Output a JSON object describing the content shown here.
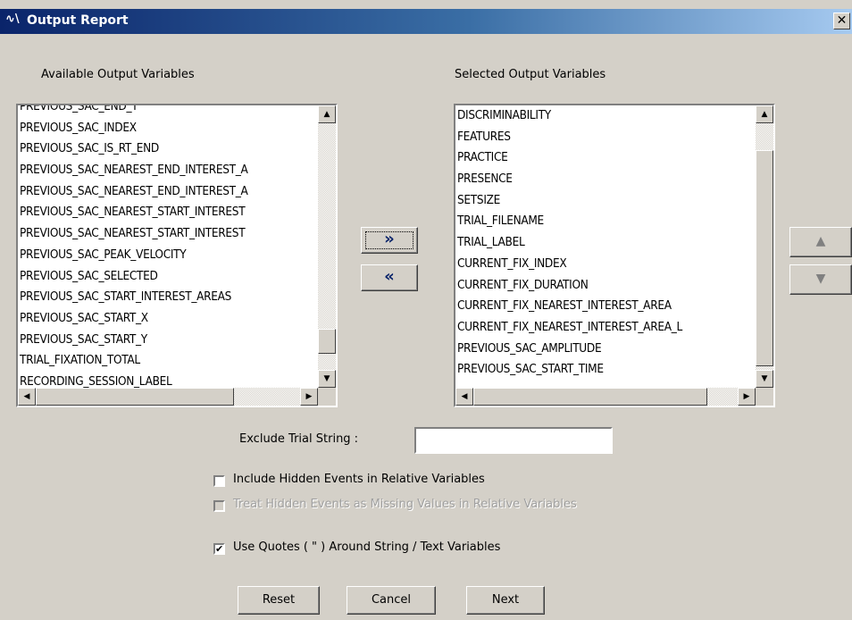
{
  "window": {
    "title": "Output Report",
    "title_icon": "∿\\",
    "close_glyph": "✕"
  },
  "available": {
    "label": "Available Output Variables",
    "items": [
      "PREVIOUS_SAC_END_Y",
      "PREVIOUS_SAC_INDEX",
      "PREVIOUS_SAC_IS_RT_END",
      "PREVIOUS_SAC_NEAREST_END_INTEREST_A",
      "PREVIOUS_SAC_NEAREST_END_INTEREST_A",
      "PREVIOUS_SAC_NEAREST_START_INTEREST",
      "PREVIOUS_SAC_NEAREST_START_INTEREST",
      "PREVIOUS_SAC_PEAK_VELOCITY",
      "PREVIOUS_SAC_SELECTED",
      "PREVIOUS_SAC_START_INTEREST_AREAS",
      "PREVIOUS_SAC_START_X",
      "PREVIOUS_SAC_START_Y",
      "TRIAL_FIXATION_TOTAL",
      "RECORDING_SESSION_LABEL"
    ]
  },
  "selected": {
    "label": "Selected Output Variables",
    "items": [
      "DISCRIMINABILITY",
      "FEATURES",
      "PRACTICE",
      "PRESENCE",
      "SETSIZE",
      "TRIAL_FILENAME",
      "TRIAL_LABEL",
      "CURRENT_FIX_INDEX",
      "CURRENT_FIX_DURATION",
      "CURRENT_FIX_NEAREST_INTEREST_AREA",
      "CURRENT_FIX_NEAREST_INTEREST_AREA_L",
      "PREVIOUS_SAC_AMPLITUDE",
      "PREVIOUS_SAC_START_TIME"
    ]
  },
  "transfer": {
    "add_label": "»",
    "remove_label": "«"
  },
  "order": {
    "up_glyph": "▲",
    "down_glyph": "▼"
  },
  "exclude": {
    "label": "Exclude Trial String :",
    "value": ""
  },
  "options": {
    "include_hidden": {
      "label": "Include Hidden Events in Relative Variables",
      "checked": false,
      "enabled": true
    },
    "treat_hidden": {
      "label": "Treat Hidden Events as Missing Values in Relative Variables",
      "checked": false,
      "enabled": false
    },
    "use_quotes": {
      "label": "Use Quotes ( \" ) Around String /  Text Variables",
      "checked": true,
      "enabled": true
    }
  },
  "buttons": {
    "reset": "Reset",
    "cancel": "Cancel",
    "next": "Next"
  },
  "icons": {
    "scroll_up": "▲",
    "scroll_down": "▼",
    "scroll_left": "◀",
    "scroll_right": "▶",
    "check": "✔"
  }
}
